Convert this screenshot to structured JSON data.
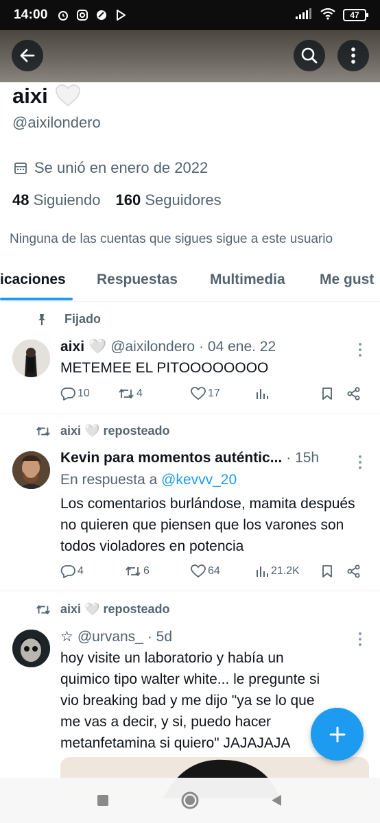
{
  "status_bar": {
    "time": "14:00",
    "battery": "47"
  },
  "profile": {
    "name": "aixi",
    "name_emoji": "🤍",
    "handle": "@aixilondero",
    "joined": "Se unió en enero de 2022",
    "following_count": "48",
    "following_label": "Siguiendo",
    "followers_count": "160",
    "followers_label": "Seguidores",
    "mutuals_note": "Ninguna de las cuentas que sigues sigue a este usuario"
  },
  "tabs": [
    "icaciones",
    "Respuestas",
    "Multimedia",
    "Me gust"
  ],
  "posts": [
    {
      "context": "Fijado",
      "author": "aixi",
      "emoji": "🤍",
      "handle": "@aixilondero",
      "time": "· 04 ene. 22",
      "text": "METEMEE EL PITOOOOOOOO",
      "replies": "10",
      "reposts": "4",
      "likes": "17",
      "views": ""
    },
    {
      "context": "aixi 🤍 reposteado",
      "author": "Kevin para momentos auténtic...",
      "time": "· 15h",
      "reply_prefix": "En respuesta a",
      "reply_to": "@kevvv_20",
      "text": "Los comentarios burlándose, mamita después no quieren que piensen que los varones son todos violadores en potencia",
      "replies": "4",
      "reposts": "6",
      "likes": "64",
      "views": "21.2K"
    },
    {
      "context": "aixi 🤍 reposteado",
      "author": "☆",
      "handle": "@urvans_",
      "time": "· 5d",
      "text": "hoy visite un laboratorio y había un quimico tipo walter white... le pregunte si vio breaking bad y me dijo \"ya se lo que me vas a decir, y si, puedo hacer metanfetamina si quiero\" JAJAJAJA"
    }
  ],
  "colors": {
    "accent": "#1d9bf0",
    "text": "#0f1419",
    "muted": "#536471"
  }
}
